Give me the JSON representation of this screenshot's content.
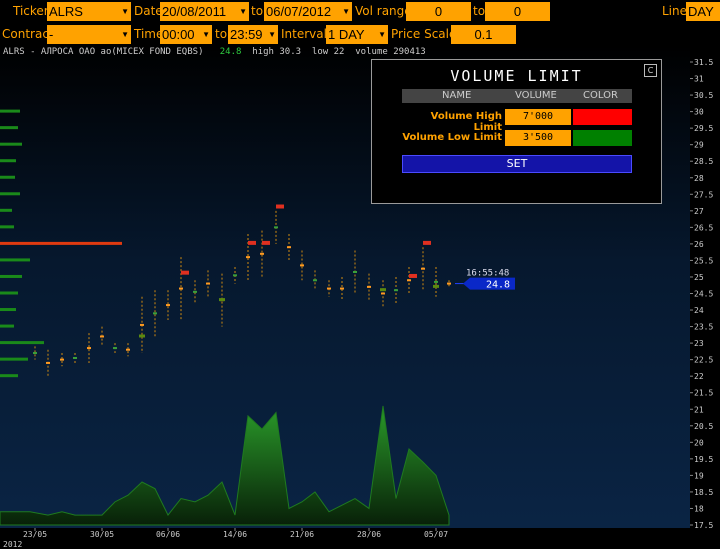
{
  "toolbar": {
    "ticker_label": "Ticker",
    "ticker_value": "ALRS",
    "date_label": "Date",
    "date_from": "20/08/2011",
    "date_to_label": "to",
    "date_to": "06/07/2012",
    "vol_range_label": "Vol range",
    "vol_from": "0",
    "vol_to_label": "to",
    "vol_to": "0",
    "line_label": "Line",
    "line_value": "DAY",
    "contract_label": "Contract",
    "contract_value": "-",
    "time_label": "Time",
    "time_from": "00:00",
    "time_to_label": "to",
    "time_to": "23:59",
    "interval_label": "Interval",
    "interval_value": "1 DAY",
    "price_scale_label": "Price Scale",
    "price_scale_value": "0.1"
  },
  "chart_info": {
    "name": "ALRS - АЛРОСА ОАО ао(MICEX FOND EQBS)",
    "last": "24.8",
    "high": "high 30.3",
    "low": "low 22",
    "volume": "volume 290413"
  },
  "volume_limit": {
    "title": "VOLUME LIMIT",
    "close": "C",
    "col_name": "NAME",
    "col_volume": "VOLUME",
    "col_color": "COLOR",
    "high_label": "Volume High Limit",
    "high_value": "7'000",
    "high_color": "#ff0000",
    "low_label": "Volume Low Limit",
    "low_value": "3'500",
    "low_color": "#008000",
    "set_label": "SET"
  },
  "colors": {
    "accent": "#ffa200",
    "background": "#000000",
    "price_tag": "#0a28c8"
  },
  "price_tag": {
    "time": "16:55:48",
    "price": "24.8"
  },
  "chart_data": {
    "type": "candlestick+volume-profile",
    "title": "ALRS - АЛРОСА ОАО ао(MICEX FOND EQBS)",
    "x_ticks": [
      "23/05",
      "30/05",
      "06/06",
      "14/06",
      "21/06",
      "28/06",
      "05/07"
    ],
    "year_label": "2012",
    "y_ticks": [
      "31.5",
      "31",
      "30.5",
      "30",
      "29.5",
      "29",
      "28.5",
      "28",
      "27.5",
      "27",
      "26.5",
      "26",
      "25.5",
      "25",
      "24.5",
      "24",
      "23.5",
      "23",
      "22.5",
      "22",
      "21.5",
      "21",
      "20.5",
      "20",
      "19.5",
      "19",
      "18.5",
      "18",
      "17.5"
    ],
    "ylim": [
      17.5,
      31.5
    ],
    "last_price": 24.8,
    "bars": [
      {
        "x": 35,
        "h": 22.9,
        "l": 22.5
      },
      {
        "x": 48,
        "h": 22.8,
        "l": 22.0
      },
      {
        "x": 62,
        "h": 22.7,
        "l": 22.3
      },
      {
        "x": 75,
        "h": 22.7,
        "l": 22.4
      },
      {
        "x": 89,
        "h": 23.3,
        "l": 22.4
      },
      {
        "x": 102,
        "h": 23.5,
        "l": 22.9
      },
      {
        "x": 115,
        "h": 23.0,
        "l": 22.7
      },
      {
        "x": 128,
        "h": 23.0,
        "l": 22.6
      },
      {
        "x": 142,
        "h": 24.4,
        "l": 22.7
      },
      {
        "x": 155,
        "h": 24.6,
        "l": 23.2
      },
      {
        "x": 168,
        "h": 24.6,
        "l": 23.7
      },
      {
        "x": 181,
        "h": 25.6,
        "l": 23.7
      },
      {
        "x": 195,
        "h": 24.9,
        "l": 24.2
      },
      {
        "x": 208,
        "h": 25.2,
        "l": 24.4
      },
      {
        "x": 222,
        "h": 25.1,
        "l": 23.5
      },
      {
        "x": 235,
        "h": 25.3,
        "l": 24.8
      },
      {
        "x": 248,
        "h": 26.3,
        "l": 24.9
      },
      {
        "x": 262,
        "h": 26.4,
        "l": 25.0
      },
      {
        "x": 276,
        "h": 27.0,
        "l": 26.0
      },
      {
        "x": 289,
        "h": 26.3,
        "l": 25.5
      },
      {
        "x": 302,
        "h": 25.8,
        "l": 24.9
      },
      {
        "x": 315,
        "h": 25.2,
        "l": 24.6
      },
      {
        "x": 329,
        "h": 24.9,
        "l": 24.4
      },
      {
        "x": 342,
        "h": 25.0,
        "l": 24.3
      },
      {
        "x": 355,
        "h": 25.8,
        "l": 24.5
      },
      {
        "x": 369,
        "h": 25.1,
        "l": 24.3
      },
      {
        "x": 383,
        "h": 24.9,
        "l": 24.1
      },
      {
        "x": 396,
        "h": 25.0,
        "l": 24.2
      },
      {
        "x": 409,
        "h": 25.3,
        "l": 24.5
      },
      {
        "x": 423,
        "h": 25.9,
        "l": 24.6
      },
      {
        "x": 436,
        "h": 25.3,
        "l": 24.4
      },
      {
        "x": 449,
        "h": 24.9,
        "l": 24.7
      }
    ],
    "volume_line": [
      [
        0,
        17.9
      ],
      [
        30,
        17.9
      ],
      [
        48,
        17.8
      ],
      [
        62,
        17.9
      ],
      [
        75,
        17.8
      ],
      [
        89,
        17.8
      ],
      [
        102,
        17.8
      ],
      [
        115,
        18.2
      ],
      [
        128,
        18.4
      ],
      [
        142,
        18.8
      ],
      [
        155,
        18.6
      ],
      [
        168,
        17.8
      ],
      [
        181,
        18.3
      ],
      [
        195,
        18.2
      ],
      [
        208,
        18.4
      ],
      [
        222,
        18.8
      ],
      [
        235,
        17.8
      ],
      [
        248,
        20.8
      ],
      [
        262,
        20.4
      ],
      [
        276,
        20.9
      ],
      [
        289,
        18.0
      ],
      [
        302,
        18.2
      ],
      [
        315,
        18.5
      ],
      [
        329,
        17.9
      ],
      [
        342,
        18.1
      ],
      [
        355,
        18.3
      ],
      [
        369,
        18.0
      ],
      [
        383,
        21.1
      ],
      [
        396,
        18.3
      ],
      [
        409,
        19.8
      ],
      [
        423,
        19.4
      ],
      [
        436,
        19.0
      ],
      [
        449,
        17.8
      ]
    ],
    "profile": [
      {
        "p": 30.0,
        "w": 20
      },
      {
        "p": 29.5,
        "w": 18
      },
      {
        "p": 29.0,
        "w": 22
      },
      {
        "p": 28.5,
        "w": 16
      },
      {
        "p": 28.0,
        "w": 15
      },
      {
        "p": 27.5,
        "w": 20
      },
      {
        "p": 27.0,
        "w": 12
      },
      {
        "p": 26.5,
        "w": 14
      },
      {
        "p": 26.0,
        "w": 122
      },
      {
        "p": 25.5,
        "w": 30
      },
      {
        "p": 25.0,
        "w": 22
      },
      {
        "p": 24.5,
        "w": 18
      },
      {
        "p": 24.0,
        "w": 16
      },
      {
        "p": 23.5,
        "w": 14
      },
      {
        "p": 23.0,
        "w": 44
      },
      {
        "p": 22.5,
        "w": 28
      },
      {
        "p": 22.0,
        "w": 18
      }
    ]
  }
}
